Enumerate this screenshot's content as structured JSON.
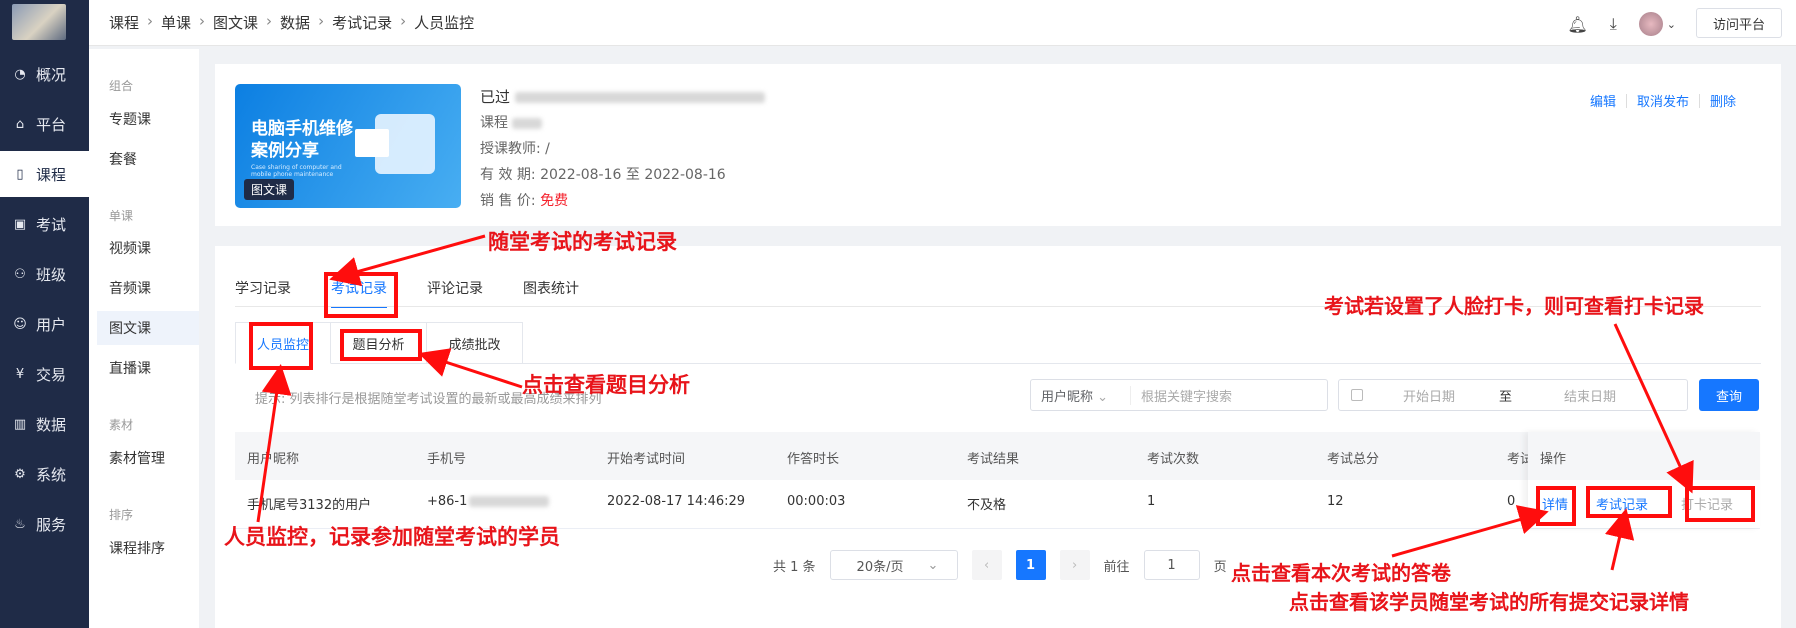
{
  "sidebar": {
    "items": [
      {
        "label": "概况",
        "icon": "pie-chart-icon",
        "active": false
      },
      {
        "label": "平台",
        "icon": "store-icon",
        "active": false
      },
      {
        "label": "课程",
        "icon": "book-icon",
        "active": true
      },
      {
        "label": "考试",
        "icon": "exam-icon",
        "active": false
      },
      {
        "label": "班级",
        "icon": "group-icon",
        "active": false
      },
      {
        "label": "用户",
        "icon": "user-icon",
        "active": false
      },
      {
        "label": "交易",
        "icon": "yen-icon",
        "active": false
      },
      {
        "label": "数据",
        "icon": "bar-chart-icon",
        "active": false
      },
      {
        "label": "系统",
        "icon": "gear-icon",
        "active": false
      },
      {
        "label": "服务",
        "icon": "service-icon",
        "active": false
      }
    ]
  },
  "subnav": {
    "groups": [
      "组合",
      "单课",
      "素材",
      "排序"
    ],
    "items": [
      "专题课",
      "套餐",
      "视频课",
      "音频课",
      "图文课",
      "直播课",
      "素材管理",
      "课程排序"
    ]
  },
  "breadcrumb": [
    "课程",
    "单课",
    "图文课",
    "数据",
    "考试记录",
    "人员监控"
  ],
  "header": {
    "visit_label": "访问平台"
  },
  "course": {
    "cover_title_1": "电脑手机维修",
    "cover_title_2": "案例分享",
    "cover_sub_1": "Case sharing of computer and",
    "cover_sub_2": "mobile phone maintenance",
    "cover_badge": "图文课",
    "title_prefix": "已过",
    "course_label": "课程",
    "teacher": "授课教师: /",
    "validity": "有 效 期: 2022-08-16 至 2022-08-16",
    "price_label": "销 售 价: ",
    "price": "免费",
    "actions": [
      "编辑",
      "取消发布",
      "删除"
    ]
  },
  "tabs": [
    "学习记录",
    "考试记录",
    "评论记录",
    "图表统计"
  ],
  "subtabs": [
    "人员监控",
    "题目分析",
    "成绩批改"
  ],
  "hint": "提示: 列表排行是根据随堂考试设置的最新或最高成绩来排列",
  "filter": {
    "select": "用户昵称",
    "placeholder": "根据关键字搜索",
    "start": "开始日期",
    "to": "至",
    "end": "结束日期",
    "query": "查询"
  },
  "table": {
    "headers": [
      "用户昵称",
      "手机号",
      "开始考试时间",
      "作答时长",
      "考试结果",
      "考试次数",
      "考试总分",
      "考试",
      "操作"
    ],
    "rows": [
      {
        "nickname": "手机尾号3132的用户",
        "phone": "+86-1",
        "start": "2022-08-17 14:46:29",
        "duration": "00:00:03",
        "result": "不及格",
        "count": "1",
        "total": "12",
        "score": "0",
        "op1": "详情",
        "op2": "考试记录",
        "op3": "打卡记录"
      }
    ]
  },
  "pagination": {
    "total": "共 1 条",
    "size": "20条/页",
    "current": "1",
    "goto_label": "前往",
    "goto_value": "1",
    "page_unit": "页"
  },
  "annotations": {
    "a1": "随堂考试的考试记录",
    "a2": "点击查看题目分析",
    "a3": "人员监控，记录参加随堂考试的学员",
    "a4": "考试若设置了人脸打卡，则可查看打卡记录",
    "a5": "点击查看本次考试的答卷",
    "a6": "点击查看该学员随堂考试的所有提交记录详情"
  },
  "colors": {
    "sidebar": "#1f2b47",
    "accent": "#1677ff",
    "annotation": "#e8141a",
    "price": "#f5222d"
  }
}
